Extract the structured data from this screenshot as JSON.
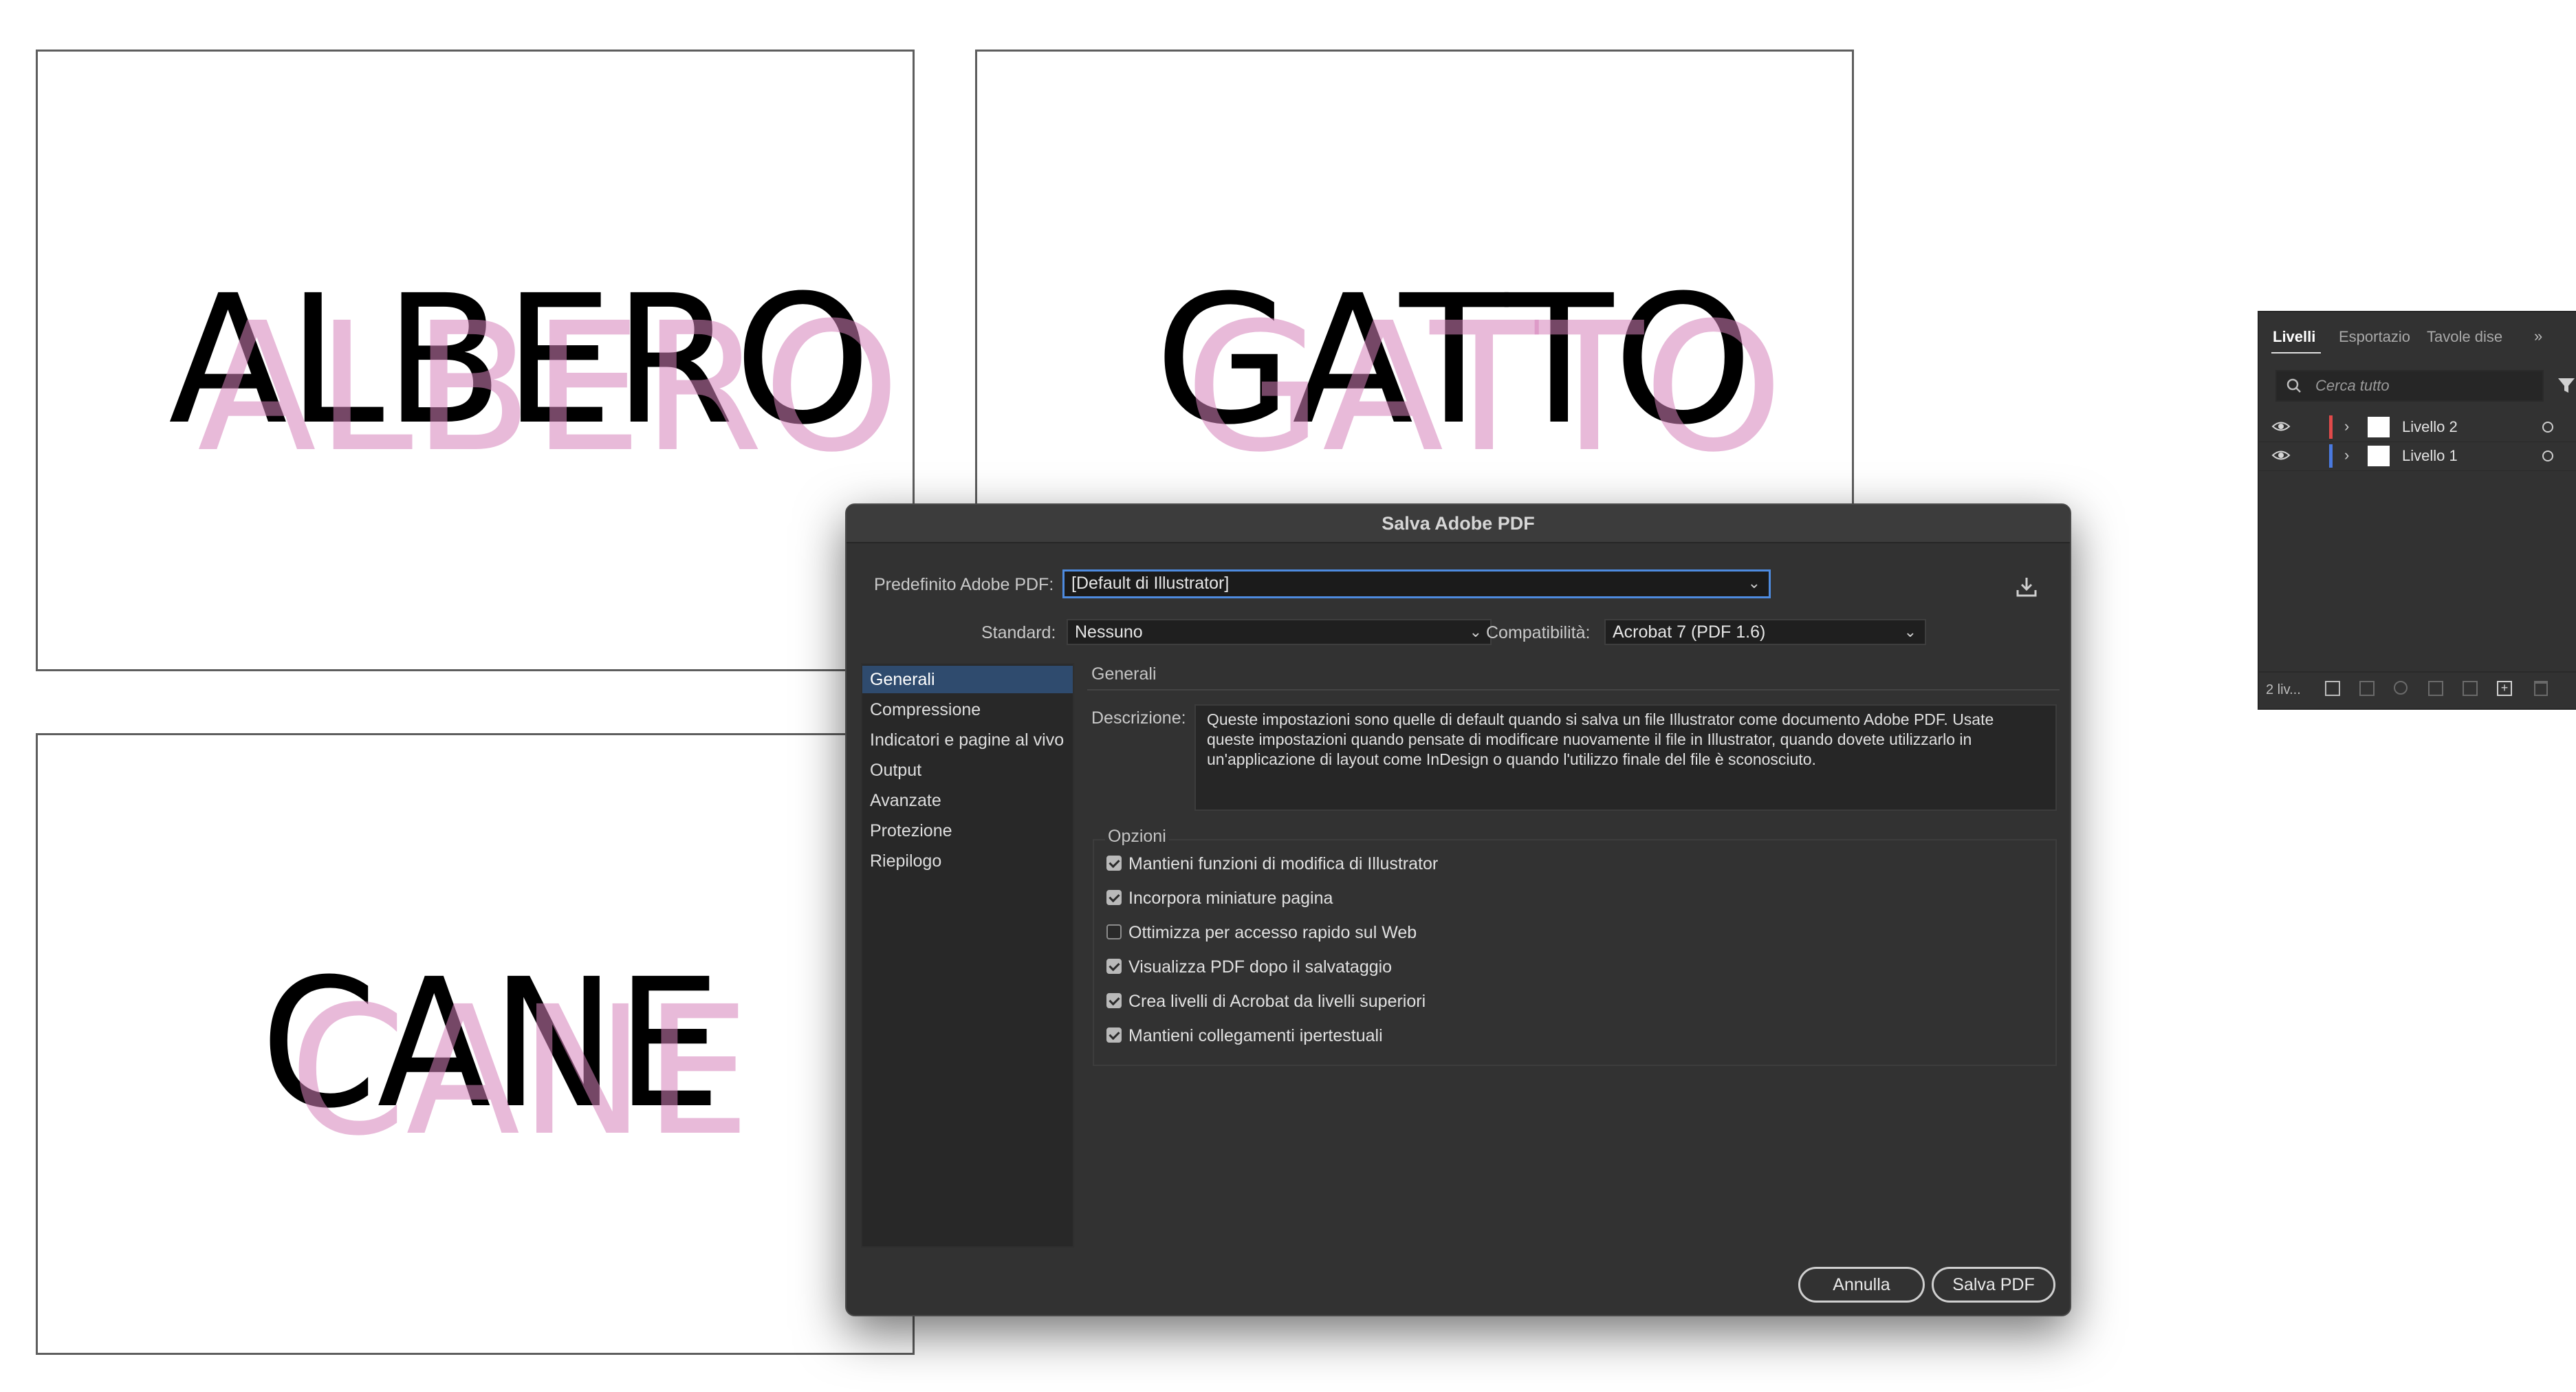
{
  "artboards": [
    {
      "word": "ALBERO"
    },
    {
      "word": "GATTO"
    },
    {
      "word": "CANE"
    }
  ],
  "dialog": {
    "title": "Salva Adobe PDF",
    "preset_label": "Predefinito Adobe PDF:",
    "preset_value": "[Default di Illustrator]",
    "standard_label": "Standard:",
    "standard_value": "Nessuno",
    "compat_label": "Compatibilità:",
    "compat_value": "Acrobat 7 (PDF 1.6)",
    "nav": [
      {
        "label": "Generali"
      },
      {
        "label": "Compressione"
      },
      {
        "label": "Indicatori e pagine al vivo"
      },
      {
        "label": "Output"
      },
      {
        "label": "Avanzate"
      },
      {
        "label": "Protezione"
      },
      {
        "label": "Riepilogo"
      }
    ],
    "section_title": "Generali",
    "description_label": "Descrizione:",
    "description_text": "Queste impostazioni sono quelle di default quando si salva un file Illustrator come documento Adobe PDF. Usate queste impostazioni quando pensate di modificare nuovamente il file in Illustrator, quando dovete utilizzarlo in un'applicazione di layout come InDesign o quando l'utilizzo finale del file è sconosciuto.",
    "options_title": "Opzioni",
    "options": [
      {
        "label": "Mantieni funzioni di modifica di Illustrator",
        "checked": true
      },
      {
        "label": "Incorpora miniature pagina",
        "checked": true
      },
      {
        "label": "Ottimizza per accesso rapido sul Web",
        "checked": false
      },
      {
        "label": "Visualizza PDF dopo il salvataggio",
        "checked": true
      },
      {
        "label": "Crea livelli di Acrobat da livelli superiori",
        "checked": true
      },
      {
        "label": "Mantieni collegamenti ipertestuali",
        "checked": true
      }
    ],
    "cancel_label": "Annulla",
    "save_label": "Salva PDF"
  },
  "layers_panel": {
    "tabs": [
      "Livelli",
      "Esportazio",
      "Tavole dise"
    ],
    "search_placeholder": "Cerca tutto",
    "layers": [
      {
        "name": "Livello 2",
        "color": "#e04a4a"
      },
      {
        "name": "Livello 1",
        "color": "#4a7ae0"
      }
    ],
    "count_label": "2 liv..."
  }
}
